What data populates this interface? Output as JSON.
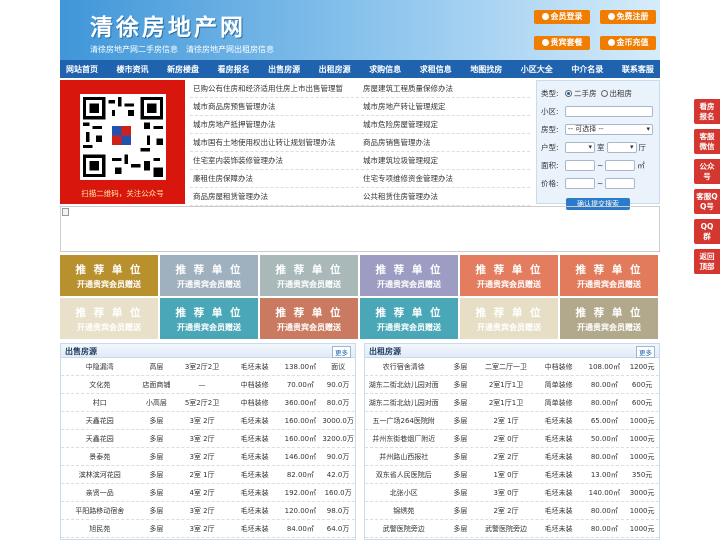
{
  "header": {
    "title": "清徐房地产网",
    "link1": "清徐房地产网二手房信息",
    "link2": "清徐房地产网出租房信息",
    "buttons": [
      "会员登录",
      "免费注册",
      "贵宾套餐",
      "金币充值"
    ]
  },
  "nav": [
    "网站首页",
    "楼市资讯",
    "新房楼盘",
    "看房报名",
    "出售房源",
    "出租房源",
    "求购信息",
    "求租信息",
    "地图找房",
    "小区大全",
    "中介名录",
    "联系客服"
  ],
  "qr": {
    "caption": "扫描二维码，关注公众号"
  },
  "news": [
    [
      "已购公有住房和经济适用住房上市出售管理暂",
      "房屋建筑工程质量保修办法"
    ],
    [
      "城市商品房预售管理办法",
      "城市房地产转让管理规定"
    ],
    [
      "城市房地产抵押管理办法",
      "城市危险房屋管理规定"
    ],
    [
      "城市国有土地使用权出让转让规划管理办法",
      "商品房销售管理办法"
    ],
    [
      "住宅室内装饰装修管理办法",
      "城市建筑垃圾管理规定"
    ],
    [
      "廉租住房保障办法",
      "住宅专项维修资金管理办法"
    ],
    [
      "商品房屋租赁管理办法",
      "公共租赁住房管理办法"
    ]
  ],
  "search": {
    "type_label": "类型:",
    "opt1": "二手房",
    "opt2": "出租房",
    "community_label": "小区:",
    "house_type_label": "房型:",
    "house_type_value": "-- 可选择 --",
    "layout_label": "户型:",
    "room": "室",
    "hall": "厅",
    "area_label": "面积:",
    "area_unit": "㎡",
    "price_label": "价格:",
    "tilde": "~",
    "submit": "确认提交搜索"
  },
  "promo": {
    "line1": "推 荐 单 位",
    "line2": "开通贵宾会员赠送"
  },
  "colors": {
    "promo": [
      "#b9902e",
      "#9fb0bf",
      "#a9b9ba",
      "#9d9dc3",
      "#e47d5f",
      "#e27b5c",
      "#e9e0c9",
      "#4aa7b8",
      "#c97a60",
      "#4aa7b8",
      "#e6dfc6",
      "#b2a98c"
    ]
  },
  "sale": {
    "title": "出售房源",
    "more": "更多",
    "rows": [
      [
        "中隐漏湾",
        "高层",
        "3室2厅2卫",
        "毛坯未装",
        "138.00㎡",
        "面议"
      ],
      [
        "文化苑",
        "店面商铺",
        "—",
        "中档装修",
        "70.00㎡",
        "90.0万"
      ],
      [
        "村口",
        "小高层",
        "5室2厅2卫",
        "中档装修",
        "360.00㎡",
        "80.0万"
      ],
      [
        "天鑫花园",
        "多层",
        "3室 2厅",
        "毛坯未装",
        "160.00㎡",
        "3000.0万"
      ],
      [
        "天鑫花园",
        "多层",
        "3室 2厅",
        "毛坯未装",
        "160.00㎡",
        "3200.0万"
      ],
      [
        "景泰苑",
        "多层",
        "3室 2厅",
        "毛坯未装",
        "146.00㎡",
        "90.0万"
      ],
      [
        "滨林滨河花园",
        "多层",
        "2室 1厅",
        "毛坯未装",
        "82.00㎡",
        "42.0万"
      ],
      [
        "亲贤一品",
        "多层",
        "4室 2厅",
        "毛坯未装",
        "192.00㎡",
        "160.0万"
      ],
      [
        "平阳路移动宿舍",
        "多层",
        "3室 2厅",
        "毛坯未装",
        "120.00㎡",
        "98.0万"
      ],
      [
        "旭民苑",
        "多层",
        "3室 2厅",
        "毛坯未装",
        "84.00㎡",
        "64.0万"
      ]
    ]
  },
  "rent": {
    "title": "出租房源",
    "more": "更多",
    "rows": [
      [
        "农行宿舍清徐",
        "多层",
        "二室二厅一卫",
        "中档装修",
        "108.00㎡",
        "1200元"
      ],
      [
        "湖东二街北幼儿园对面",
        "多层",
        "2室1厅1卫",
        "简单装修",
        "80.00㎡",
        "600元"
      ],
      [
        "湖东二街北幼儿园对面",
        "多层",
        "2室1厅1卫",
        "简单装修",
        "80.00㎡",
        "600元"
      ],
      [
        "五一广场264医院附",
        "多层",
        "2室 1厅",
        "毛坯未装",
        "65.00㎡",
        "1000元"
      ],
      [
        "并州东街巷烟厂附近",
        "多层",
        "2室 0厅",
        "毛坯未装",
        "50.00㎡",
        "1000元"
      ],
      [
        "并州路山西报社",
        "多层",
        "2室 2厅",
        "毛坯未装",
        "80.00㎡",
        "1000元"
      ],
      [
        "双东省人民医院后",
        "多层",
        "1室 0厅",
        "毛坯未装",
        "13.00㎡",
        "350元"
      ],
      [
        "北张小区",
        "多层",
        "3室 0厅",
        "毛坯未装",
        "140.00㎡",
        "3000元"
      ],
      [
        "锦绣苑",
        "多层",
        "2室 2厅",
        "毛坯未装",
        "80.00㎡",
        "1000元"
      ],
      [
        "武警医院旁边",
        "多层",
        "武警医院旁边",
        "毛坯未装",
        "80.00㎡",
        "1000元"
      ]
    ]
  },
  "right_bar": [
    "看房报名",
    "客服微信",
    "公众号",
    "客服QQ号",
    "QQ群",
    "返回顶部"
  ]
}
